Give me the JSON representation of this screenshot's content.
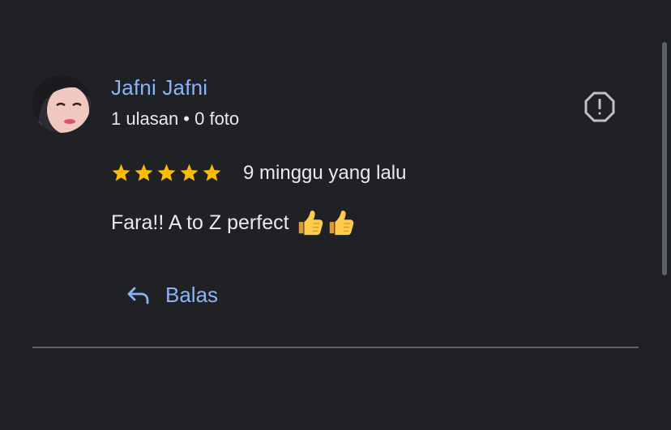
{
  "review": {
    "reviewer_name": "Jafni Jafni",
    "reviewer_meta": "1 ulasan • 0 foto",
    "rating": 5,
    "max_rating": 5,
    "time_ago": "9 minggu yang lalu",
    "text": "Fara!! A to Z perfect",
    "emojis": [
      "thumbs-up-icon",
      "thumbs-up-icon"
    ]
  },
  "actions": {
    "reply_label": "Balas",
    "report_icon": "report-icon"
  },
  "colors": {
    "background": "#202124",
    "accent": "#8ab4f8",
    "star": "#fbbc04",
    "text": "#e8eaed",
    "divider": "#5f6368"
  }
}
